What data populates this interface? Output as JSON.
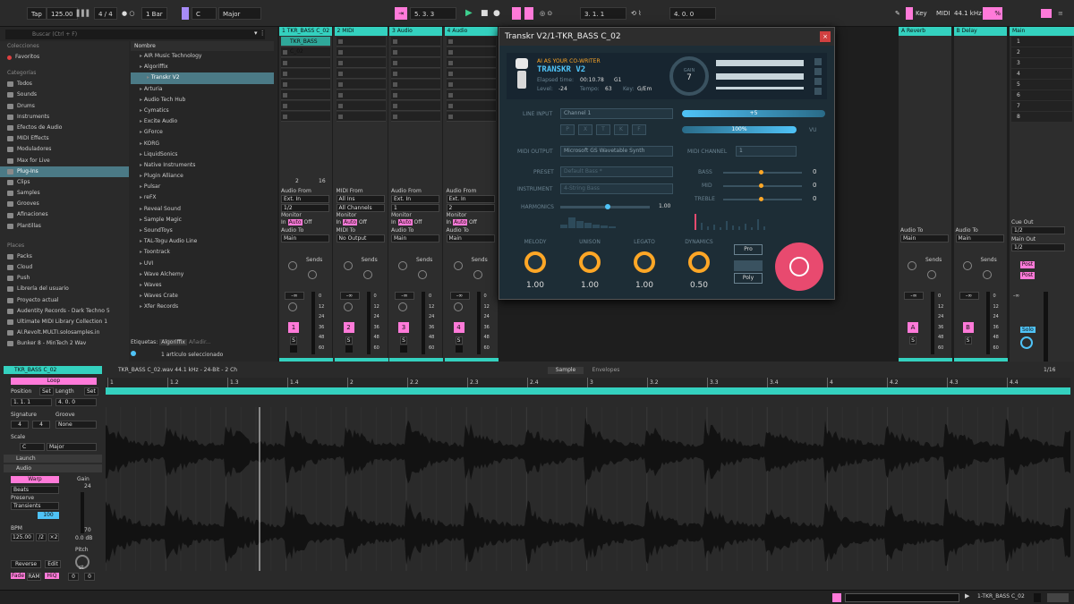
{
  "topbar": {
    "tap": "Tap",
    "tempo": "125.00",
    "signature": "4 / 4",
    "quantize": "1 Bar",
    "key": "C",
    "scale": "Major",
    "position": "5.   3.   3",
    "loop_start": "3.   1.   1",
    "loop_length": "4.   0.   0",
    "key_label": "Key",
    "midi_label": "MIDI",
    "sample_rate": "44.1 kHz",
    "cpu": "%"
  },
  "browser": {
    "search_placeholder": "Buscar (Ctrl + F)",
    "collections_header": "Colecciones",
    "favorites": "Favoritos",
    "categories_header": "Categorías",
    "categories": [
      "Todos",
      "Sounds",
      "Drums",
      "Instruments",
      "Efectos de Audio",
      "MIDI Effects",
      "Moduladores",
      "Max for Live",
      "Plug-Ins",
      "Clips",
      "Samples",
      "Grooves",
      "Afinaciones",
      "Plantillas"
    ],
    "selected_category": "Plug-Ins",
    "places_header": "Places",
    "places": [
      "Packs",
      "Cloud",
      "Push",
      "Librería del usuario",
      "Proyecto actual",
      "Audentity Records - Dark Techno 5",
      "Ultimate MIDI Library Collection 1",
      "AI.Revolt.MULTI.solosamples.in",
      "Bunker 8 - MinTech 2 Wav"
    ],
    "list_header": "Nombre",
    "list": [
      "AIR Music Technology",
      "Algoriffix",
      "Transkr V2",
      "Arturia",
      "Audio Tech Hub",
      "Cymatics",
      "Excite Audio",
      "GForce",
      "KORG",
      "LiquidSonics",
      "Native Instruments",
      "Plugin Alliance",
      "Pulsar",
      "reFX",
      "Reveal Sound",
      "Sample Magic",
      "SoundToys",
      "TAL-Togu Audio Line",
      "Toontrack",
      "UVI",
      "Wave Alchemy",
      "Waves",
      "Waves Crate",
      "Xfer Records"
    ],
    "selected_item": "Transkr V2",
    "tags_label": "Etiquetas:",
    "tag_value": "Algoriffix",
    "tag_add": "Añadir...",
    "status": "1 artículo seleccionado"
  },
  "tracks": [
    {
      "name": "1 TKR_BASS C_02",
      "num": "1",
      "clip": "TKR_BASS C_02",
      "audio_from": "Ext. In",
      "channel": "1/2",
      "audio_to": "Main",
      "io_label": "Audio From",
      "to_label": "Audio To"
    },
    {
      "name": "2 MIDI",
      "num": "2",
      "clip": "",
      "audio_from": "All Ins",
      "channel": "All Channels",
      "audio_to": "No Output",
      "io_label": "MIDI From",
      "to_label": "MIDI To"
    },
    {
      "name": "3 Audio",
      "num": "3",
      "clip": "",
      "audio_from": "Ext. In",
      "channel": "1",
      "audio_to": "Main",
      "io_label": "Audio From",
      "to_label": "Audio To"
    },
    {
      "name": "4 Audio",
      "num": "4",
      "clip": "",
      "audio_from": "Ext. In",
      "channel": "2",
      "audio_to": "Main",
      "io_label": "Audio From",
      "to_label": "Audio To"
    }
  ],
  "returns": [
    {
      "name": "A Reverb",
      "num": "A",
      "audio_to": "Main"
    },
    {
      "name": "B Delay",
      "num": "B",
      "audio_to": "Main"
    }
  ],
  "main_track": {
    "name": "Main",
    "cue_out_label": "Cue Out",
    "cue_out": "1/2",
    "main_out_label": "Main Out",
    "main_out": "1/2",
    "scenes": [
      "1",
      "2",
      "3",
      "4",
      "5",
      "6",
      "7",
      "8"
    ],
    "solo": "Solo"
  },
  "mixer": {
    "monitor": "Monitor",
    "in": "In",
    "auto": "Auto",
    "off": "Off",
    "sends": "Sends",
    "vol": "-∞",
    "meter_ticks": [
      "0",
      "12",
      "24",
      "36",
      "48",
      "60"
    ],
    "post": "Post",
    "s": "S",
    "count_a": "2",
    "count_b": "16"
  },
  "plugin": {
    "title": "Transkr V2/1-TKR_BASS C_02",
    "tagline": "AI AS YOUR CO-WRITER",
    "product": "TRANSKR V2",
    "elapsed_label": "Elapsed time:",
    "elapsed": "00:10.78",
    "bar": "G1",
    "level_label": "Level:",
    "level": "-24",
    "tempo_label": "Tempo:",
    "tempo": "63",
    "key_label": "Key:",
    "key": "G/Em",
    "gain_label": "GAIN",
    "gain": "7",
    "line_input_label": "LINE INPUT",
    "line_input": "Channel 1",
    "vu_plus": "+5",
    "vu_pct": "100%",
    "vu": "VU",
    "input_buttons": [
      "P",
      "X",
      "T",
      "K",
      "F"
    ],
    "midi_output_label": "MIDI OUTPUT",
    "midi_output": "Microsoft GS Wavetable Synth",
    "midi_channel_label": "MIDI CHANNEL",
    "midi_channel": "1",
    "preset_label": "PRESET",
    "preset": "Default Bass *",
    "instrument_label": "INSTRUMENT",
    "instrument": "4-String Bass",
    "harmonics_label": "HARMONICS",
    "harmonics": "1.00",
    "bass_label": "BASS",
    "bass": "0",
    "mid_label": "MID",
    "mid": "0",
    "treble_label": "TREBLE",
    "treble": "0",
    "knobs": [
      {
        "label": "MELODY",
        "value": "1.00"
      },
      {
        "label": "UNISON",
        "value": "1.00"
      },
      {
        "label": "LEGATO",
        "value": "1.00"
      },
      {
        "label": "DYNAMICS",
        "value": "0.50"
      }
    ],
    "mode_pro": "Pro",
    "mode_poly": "Poly",
    "colors": {
      "accent": "#ffa726",
      "bg": "#1d2d36",
      "record": "#e84a6f",
      "meter": "#4fc3f7"
    }
  },
  "clip": {
    "name": "TKR_BASS C_02",
    "loop": "Loop",
    "position_label": "Position",
    "set": "Set",
    "length_label": "Length",
    "position": "1.   1.   1",
    "length": "4.   0.   0",
    "signature_label": "Signature",
    "groove_label": "Groove",
    "sig_num": "4",
    "sig_den": "4",
    "groove": "None",
    "scale_label": "Scale",
    "scale_key": "C",
    "scale_mode": "Major",
    "launch": "Launch",
    "audio": "Audio",
    "warp": "Warp",
    "warp_mode": "Beats",
    "preserve_label": "Preserve",
    "preserve": "Transients",
    "loop_val": "100",
    "gain_label": "Gain",
    "gain_db": "0.0 dB",
    "gain_top": "24",
    "gain_bottom": "70",
    "bpm_label": "BPM",
    "bpm": "125.00",
    "half": "/2",
    "double": "×2",
    "pitch_label": "Pitch",
    "pitch_unit": "st",
    "pitch": "0",
    "pitch_fine": "0",
    "reverse": "Reverse",
    "edit": "Edit",
    "fade": "Fade",
    "ram": "RAM",
    "hiq": "HiQ"
  },
  "sample": {
    "info": "TKR_BASS C_02.wav 44.1 kHz - 24-Bit - 2 Ch",
    "tab_sample": "Sample",
    "tab_envelopes": "Envelopes",
    "grid": "1/16",
    "ruler": [
      "1",
      "1.2",
      "1.3",
      "1.4",
      "2",
      "2.2",
      "2.3",
      "2.4",
      "3",
      "3.2",
      "3.3",
      "3.4",
      "4",
      "4.2",
      "4.3",
      "4.4"
    ]
  },
  "status": {
    "selected_track": "1-TKR_BASS C_02"
  }
}
